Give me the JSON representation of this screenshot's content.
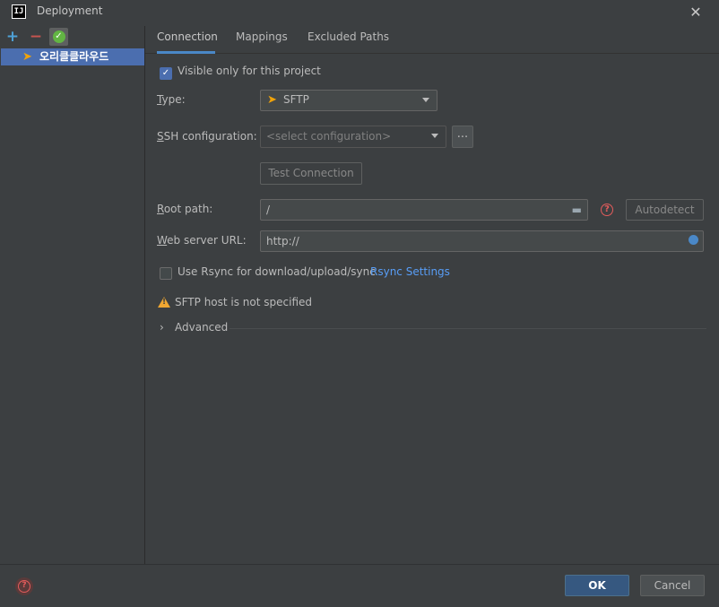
{
  "window": {
    "title": "Deployment",
    "app_logo": "IJ"
  },
  "left": {
    "server": {
      "name": "오리클클라우드",
      "icon": "sftp-server-icon"
    }
  },
  "tabs": [
    "Connection",
    "Mappings",
    "Excluded Paths"
  ],
  "form": {
    "visible_only": {
      "label": "Visible only for this project",
      "checked": true
    },
    "type": {
      "label_rest": "ype:",
      "label_mnemonic": "T",
      "value": "SFTP"
    },
    "ssh": {
      "label_mnemonic": "S",
      "label_rest": "SH configuration:",
      "placeholder": "<select configuration>",
      "more": "..."
    },
    "test_connection": "Test Connection",
    "root_path": {
      "label_mnemonic": "R",
      "label_rest": "oot path:",
      "value": "/",
      "autodetect": "Autodetect"
    },
    "web_url": {
      "label_mnemonic": "W",
      "label_rest": "eb server URL:",
      "value": "http://"
    },
    "rsync": {
      "label": "Use Rsync for download/upload/sync",
      "checked": false,
      "settings_link": "Rsync Settings"
    },
    "warning": "SFTP host is not specified",
    "advanced": "Advanced"
  },
  "footer": {
    "ok": "OK",
    "cancel": "Cancel"
  }
}
